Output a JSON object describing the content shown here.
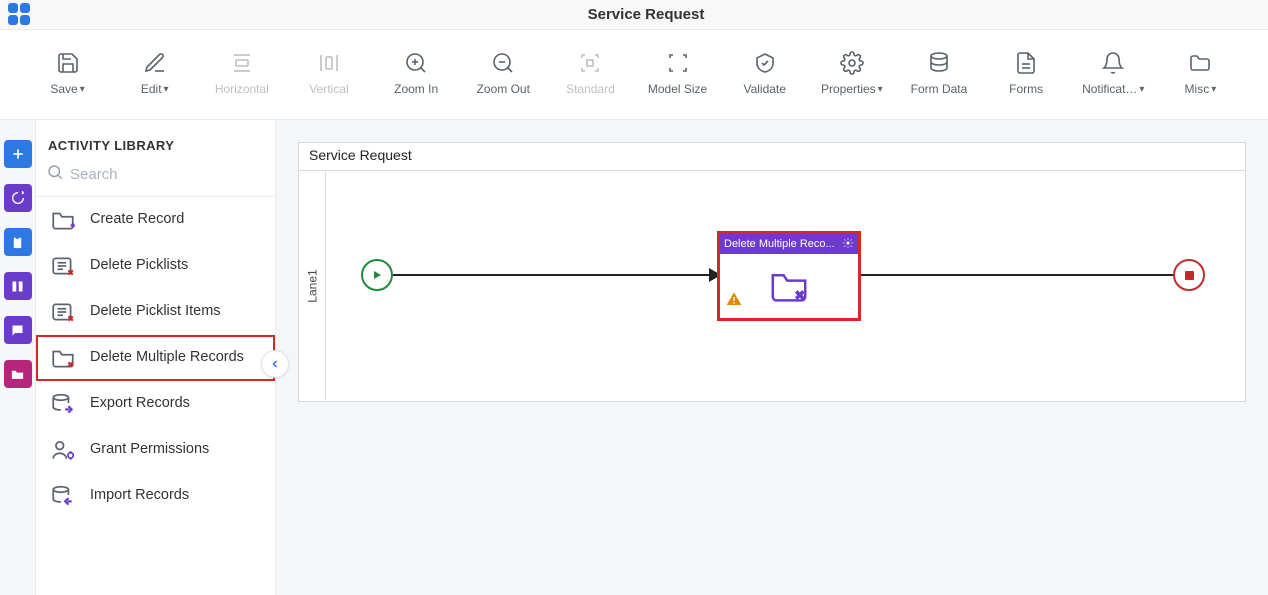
{
  "header": {
    "title": "Service Request"
  },
  "toolbar": [
    {
      "id": "save",
      "label": "Save",
      "dropdown": true,
      "enabled": true
    },
    {
      "id": "edit",
      "label": "Edit",
      "dropdown": true,
      "enabled": true
    },
    {
      "id": "horizontal",
      "label": "Horizontal",
      "dropdown": false,
      "enabled": false
    },
    {
      "id": "vertical",
      "label": "Vertical",
      "dropdown": false,
      "enabled": false
    },
    {
      "id": "zoom-in",
      "label": "Zoom In",
      "dropdown": false,
      "enabled": true
    },
    {
      "id": "zoom-out",
      "label": "Zoom Out",
      "dropdown": false,
      "enabled": true
    },
    {
      "id": "standard",
      "label": "Standard",
      "dropdown": false,
      "enabled": false
    },
    {
      "id": "model-size",
      "label": "Model Size",
      "dropdown": false,
      "enabled": true
    },
    {
      "id": "validate",
      "label": "Validate",
      "dropdown": false,
      "enabled": true
    },
    {
      "id": "properties",
      "label": "Properties",
      "dropdown": true,
      "enabled": true
    },
    {
      "id": "form-data",
      "label": "Form Data",
      "dropdown": false,
      "enabled": true
    },
    {
      "id": "forms",
      "label": "Forms",
      "dropdown": false,
      "enabled": true
    },
    {
      "id": "notifications",
      "label": "Notificat…",
      "dropdown": true,
      "enabled": true
    },
    {
      "id": "misc",
      "label": "Misc",
      "dropdown": true,
      "enabled": true
    }
  ],
  "sidebar": {
    "title": "ACTIVITY LIBRARY",
    "search_placeholder": "Search",
    "items": [
      {
        "label": "Create Record",
        "icon": "folder-plus"
      },
      {
        "label": "Delete Picklists",
        "icon": "list-x"
      },
      {
        "label": "Delete Picklist Items",
        "icon": "list-x"
      },
      {
        "label": "Delete Multiple Records",
        "icon": "folder-x",
        "highlight": true
      },
      {
        "label": "Export Records",
        "icon": "db-arrow"
      },
      {
        "label": "Grant Permissions",
        "icon": "user-gear"
      },
      {
        "label": "Import Records",
        "icon": "db-arrow"
      }
    ]
  },
  "iconrail": [
    {
      "name": "add",
      "bg": "#2d78e2"
    },
    {
      "name": "loop",
      "bg": "#6b3cc9"
    },
    {
      "name": "clipboard",
      "bg": "#2d78e2"
    },
    {
      "name": "columns",
      "bg": "#6b3cc9"
    },
    {
      "name": "chat",
      "bg": "#6b3cc9"
    },
    {
      "name": "folder",
      "bg": "#b7257a"
    }
  ],
  "canvas": {
    "pool_title": "Service Request",
    "lane_label": "Lane1",
    "activity": {
      "title": "Delete Multiple Reco...",
      "icon": "folder-x",
      "warning": true
    }
  }
}
